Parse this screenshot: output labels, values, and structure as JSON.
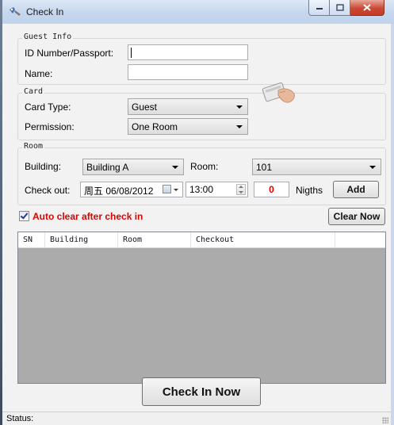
{
  "window": {
    "title": "Check In"
  },
  "guest_info": {
    "legend": "Guest Info",
    "id_label": "ID Number/Passport:",
    "id_value": "",
    "name_label": "Name:",
    "name_value": ""
  },
  "card": {
    "legend": "Card",
    "type_label": "Card Type:",
    "type_value": "Guest",
    "permission_label": "Permission:",
    "permission_value": "One Room"
  },
  "room": {
    "legend": "Room",
    "building_label": "Building:",
    "building_value": "Building A",
    "room_label": "Room:",
    "room_value": "101",
    "checkout_label": "Check out:",
    "checkout_date": "周五 06/08/2012",
    "checkout_time": "13:00",
    "nights_value": "0",
    "nights_label": "Nigths",
    "add_label": "Add"
  },
  "options": {
    "auto_clear_label": "Auto clear after check in",
    "auto_clear_checked": true,
    "clear_now_label": "Clear Now"
  },
  "table": {
    "columns": [
      "SN",
      "Building",
      "Room",
      "Checkout"
    ],
    "rows": []
  },
  "actions": {
    "check_in_label": "Check In Now"
  },
  "status": {
    "label": "Status:"
  }
}
